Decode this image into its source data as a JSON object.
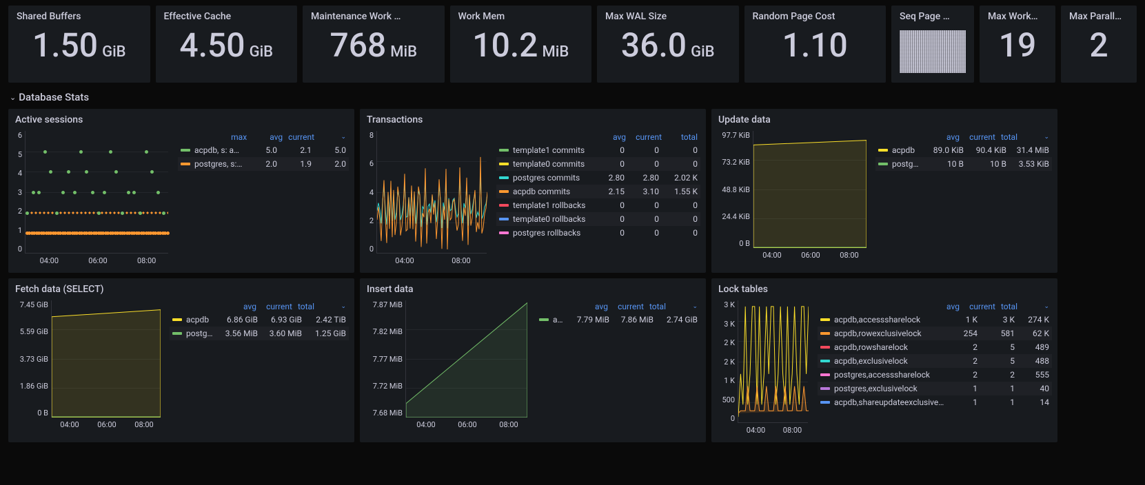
{
  "stats": [
    {
      "title": "Shared Buffers",
      "value": "1.50",
      "unit": "GiB"
    },
    {
      "title": "Effective Cache",
      "value": "4.50",
      "unit": "GiB"
    },
    {
      "title": "Maintenance Work …",
      "value": "768",
      "unit": "MiB"
    },
    {
      "title": "Work Mem",
      "value": "10.2",
      "unit": "MiB"
    },
    {
      "title": "Max WAL Size",
      "value": "36.0",
      "unit": "GiB"
    },
    {
      "title": "Random Page Cost",
      "value": "1.10",
      "unit": ""
    },
    {
      "title": "Seq Page …",
      "value": "",
      "unit": "",
      "noise": true
    },
    {
      "title": "Max Work…",
      "value": "19",
      "unit": ""
    },
    {
      "title": "Max Parall…",
      "value": "2",
      "unit": ""
    }
  ],
  "section": "Database Stats",
  "active_sessions": {
    "title": "Active sessions",
    "y": [
      "6",
      "5",
      "4",
      "3",
      "2",
      "1",
      "0"
    ],
    "x": [
      "04:00",
      "06:00",
      "08:00"
    ],
    "head": [
      "max",
      "avg",
      "current"
    ],
    "rows": [
      {
        "c": "c-green",
        "l": "acpdb, s: active",
        "v": [
          "5.0",
          "2.1",
          "5.0"
        ]
      },
      {
        "c": "c-orange",
        "l": "postgres, s: active",
        "v": [
          "2.0",
          "1.9",
          "2.0"
        ]
      }
    ]
  },
  "transactions": {
    "title": "Transactions",
    "y": [
      "8",
      "6",
      "4",
      "2",
      "0"
    ],
    "x": [
      "04:00",
      "08:00"
    ],
    "head": [
      "avg",
      "current",
      "total"
    ],
    "rows": [
      {
        "c": "c-green",
        "l": "template1 commits",
        "v": [
          "0",
          "0",
          "0"
        ]
      },
      {
        "c": "c-yellow",
        "l": "template0 commits",
        "v": [
          "0",
          "0",
          "0"
        ]
      },
      {
        "c": "c-cyan",
        "l": "postgres commits",
        "v": [
          "2.80",
          "2.80",
          "2.02 K"
        ]
      },
      {
        "c": "c-orange",
        "l": "acpdb commits",
        "v": [
          "2.15",
          "3.10",
          "1.55 K"
        ]
      },
      {
        "c": "c-red",
        "l": "template1 rollbacks",
        "v": [
          "0",
          "0",
          "0"
        ]
      },
      {
        "c": "c-blue",
        "l": "template0 rollbacks",
        "v": [
          "0",
          "0",
          "0"
        ]
      },
      {
        "c": "c-mag",
        "l": "postgres rollbacks",
        "v": [
          "0",
          "0",
          "0"
        ]
      }
    ]
  },
  "update_data": {
    "title": "Update data",
    "y": [
      "97.7 KiB",
      "73.2 KiB",
      "48.8 KiB",
      "24.4 KiB",
      "0 B"
    ],
    "x": [
      "04:00",
      "06:00",
      "08:00"
    ],
    "head": [
      "avg",
      "current",
      "total"
    ],
    "rows": [
      {
        "c": "c-yellow",
        "l": "acpdb",
        "v": [
          "89.0 KiB",
          "90.4 KiB",
          "31.4 MiB"
        ]
      },
      {
        "c": "c-green",
        "l": "postgres",
        "v": [
          "10 B",
          "10 B",
          "3.53 KiB"
        ]
      }
    ]
  },
  "fetch_data": {
    "title": "Fetch data (SELECT)",
    "y": [
      "7.45 GiB",
      "5.59 GiB",
      "3.73 GiB",
      "1.86 GiB",
      "0 B"
    ],
    "x": [
      "04:00",
      "06:00",
      "08:00"
    ],
    "head": [
      "avg",
      "current",
      "total"
    ],
    "rows": [
      {
        "c": "c-yellow",
        "l": "acpdb",
        "v": [
          "6.86 GiB",
          "6.93 GiB",
          "2.42 TiB"
        ]
      },
      {
        "c": "c-green",
        "l": "postgres",
        "v": [
          "3.56 MiB",
          "3.60 MiB",
          "1.25 GiB"
        ]
      }
    ]
  },
  "insert_data": {
    "title": "Insert data",
    "y": [
      "7.87 MiB",
      "7.82 MiB",
      "7.77 MiB",
      "7.72 MiB",
      "7.68 MiB"
    ],
    "x": [
      "04:00",
      "06:00",
      "08:00"
    ],
    "head": [
      "avg",
      "current",
      "total"
    ],
    "rows": [
      {
        "c": "c-green",
        "l": "acpdb",
        "v": [
          "7.79 MiB",
          "7.86 MiB",
          "2.74 GiB"
        ]
      }
    ]
  },
  "lock_tables": {
    "title": "Lock tables",
    "y": [
      "3 K",
      "3 K",
      "2 K",
      "2 K",
      "1 K",
      "500",
      "0"
    ],
    "x": [
      "04:00",
      "08:00"
    ],
    "head": [
      "avg",
      "current",
      "total"
    ],
    "rows": [
      {
        "c": "c-yellow",
        "l": "acpdb,accesssharelock",
        "v": [
          "1 K",
          "3 K",
          "274 K"
        ]
      },
      {
        "c": "c-orange",
        "l": "acpdb,rowexclusivelock",
        "v": [
          "254",
          "581",
          "62 K"
        ]
      },
      {
        "c": "c-red",
        "l": "acpdb,rowsharelock",
        "v": [
          "2",
          "5",
          "489"
        ]
      },
      {
        "c": "c-cyan",
        "l": "acpdb,exclusivelock",
        "v": [
          "2",
          "5",
          "488"
        ]
      },
      {
        "c": "c-mag",
        "l": "postgres,accesssharelock",
        "v": [
          "2",
          "2",
          "555"
        ]
      },
      {
        "c": "c-purple",
        "l": "postgres,exclusivelock",
        "v": [
          "1",
          "1",
          "40"
        ]
      },
      {
        "c": "c-blue",
        "l": "acpdb,shareupdateexclusivelock",
        "v": [
          "1",
          "1",
          "14"
        ]
      }
    ]
  },
  "chart_data": [
    {
      "type": "scatter",
      "title": "Active sessions",
      "xlabel": "",
      "ylabel": "",
      "ylim": [
        0,
        6
      ],
      "series": [
        {
          "name": "acpdb, s: active",
          "max": 5.0,
          "avg": 2.1,
          "current": 5.0
        },
        {
          "name": "postgres, s: active",
          "max": 2.0,
          "avg": 1.9,
          "current": 2.0
        }
      ]
    },
    {
      "type": "line",
      "title": "Transactions",
      "ylim": [
        0,
        8
      ],
      "series": [
        {
          "name": "template1 commits",
          "avg": 0,
          "current": 0,
          "total": 0
        },
        {
          "name": "template0 commits",
          "avg": 0,
          "current": 0,
          "total": 0
        },
        {
          "name": "postgres commits",
          "avg": 2.8,
          "current": 2.8,
          "total": 2020
        },
        {
          "name": "acpdb commits",
          "avg": 2.15,
          "current": 3.1,
          "total": 1550
        },
        {
          "name": "template1 rollbacks",
          "avg": 0,
          "current": 0,
          "total": 0
        },
        {
          "name": "template0 rollbacks",
          "avg": 0,
          "current": 0,
          "total": 0
        },
        {
          "name": "postgres rollbacks",
          "avg": 0,
          "current": 0,
          "total": 0
        }
      ]
    },
    {
      "type": "line",
      "title": "Update data",
      "ylim_label": [
        "0 B",
        "97.7 KiB"
      ],
      "series": [
        {
          "name": "acpdb",
          "avg": "89.0 KiB",
          "current": "90.4 KiB",
          "total": "31.4 MiB"
        },
        {
          "name": "postgres",
          "avg": "10 B",
          "current": "10 B",
          "total": "3.53 KiB"
        }
      ]
    },
    {
      "type": "area",
      "title": "Fetch data (SELECT)",
      "ylim_label": [
        "0 B",
        "7.45 GiB"
      ],
      "series": [
        {
          "name": "acpdb",
          "avg": "6.86 GiB",
          "current": "6.93 GiB",
          "total": "2.42 TiB"
        },
        {
          "name": "postgres",
          "avg": "3.56 MiB",
          "current": "3.60 MiB",
          "total": "1.25 GiB"
        }
      ]
    },
    {
      "type": "line",
      "title": "Insert data",
      "ylim_label": [
        "7.68 MiB",
        "7.87 MiB"
      ],
      "series": [
        {
          "name": "acpdb",
          "avg": "7.79 MiB",
          "current": "7.86 MiB",
          "total": "2.74 GiB"
        }
      ]
    },
    {
      "type": "line",
      "title": "Lock tables",
      "ylim_label": [
        "0",
        "3 K"
      ],
      "series": [
        {
          "name": "acpdb,accesssharelock",
          "avg": 1000,
          "current": 3000,
          "total": 274000
        },
        {
          "name": "acpdb,rowexclusivelock",
          "avg": 254,
          "current": 581,
          "total": 62000
        },
        {
          "name": "acpdb,rowsharelock",
          "avg": 2,
          "current": 5,
          "total": 489
        },
        {
          "name": "acpdb,exclusivelock",
          "avg": 2,
          "current": 5,
          "total": 488
        },
        {
          "name": "postgres,accesssharelock",
          "avg": 2,
          "current": 2,
          "total": 555
        },
        {
          "name": "postgres,exclusivelock",
          "avg": 1,
          "current": 1,
          "total": 40
        },
        {
          "name": "acpdb,shareupdateexclusivelock",
          "avg": 1,
          "current": 1,
          "total": 14
        }
      ]
    }
  ]
}
